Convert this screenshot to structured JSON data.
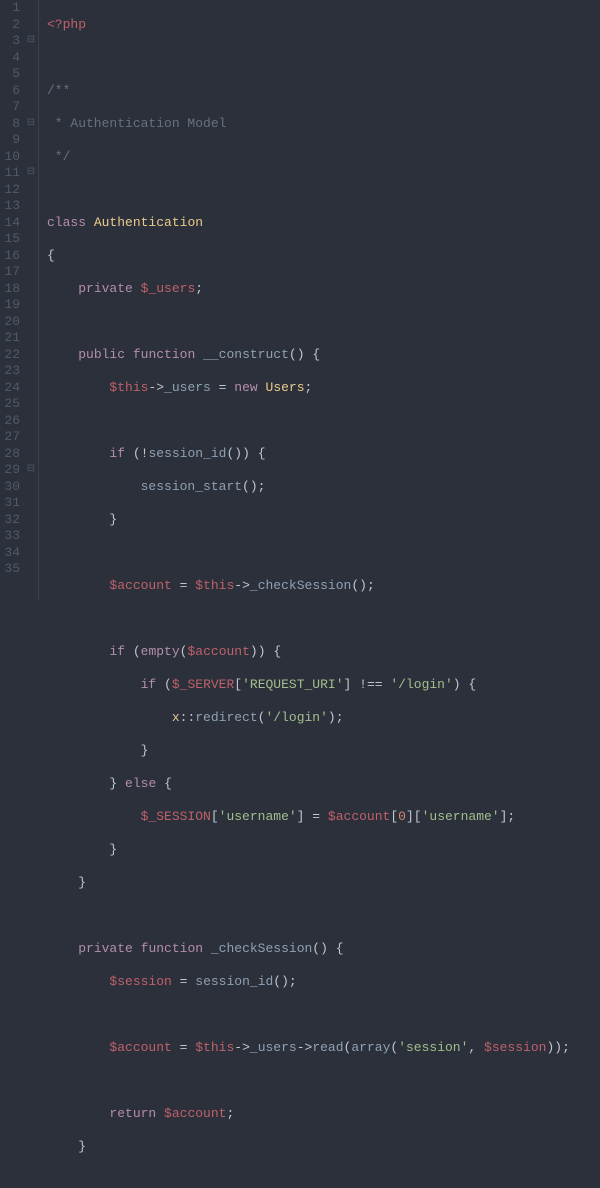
{
  "lineNumbers": [
    "1",
    "2",
    "3",
    "4",
    "5",
    "6",
    "7",
    "8",
    "9",
    "10",
    "11",
    "12",
    "13",
    "14",
    "15",
    "16",
    "17",
    "18",
    "19",
    "20",
    "21",
    "22",
    "23",
    "24",
    "25",
    "26",
    "27",
    "28",
    "29",
    "30",
    "31",
    "32",
    "33",
    "34",
    "35"
  ],
  "folds": {
    "l3": "⊟",
    "l8": "⊟",
    "l11": "⊟",
    "l29": "⊟"
  },
  "tokens": {
    "php_open": "<?php",
    "cmt1": "/**",
    "cmt2": " * Authentication Model",
    "cmt3": " */",
    "kw_class": "class",
    "cls_name": "Authentication",
    "brace_o": "{",
    "brace_c": "}",
    "kw_private": "private",
    "kw_public": "public",
    "kw_function": "function",
    "kw_new": "new",
    "kw_if": "if",
    "kw_else": "else",
    "kw_return": "return",
    "kw_empty": "empty",
    "var_users": "$_users",
    "var_this": "$this",
    "var_account": "$account",
    "var_session": "$session",
    "var_server": "$_SERVER",
    "var_SESSION": "$_SESSION",
    "fn_construct": "__construct",
    "fn_checkSession": "_checkSession",
    "fn_sessionid": "session_id",
    "fn_sessionstart": "session_start",
    "fn_read": "read",
    "fn_redirect": "redirect",
    "fn_array": "array",
    "cls_users": "Users",
    "cls_x": "x",
    "prop_users": "_users",
    "str_requri": "'REQUEST_URI'",
    "str_login": "'/login'",
    "str_username": "'username'",
    "str_session": "'session'",
    "num_0": "0",
    "op_arrow": "->",
    "op_eq": "=",
    "op_neq": "!==",
    "op_sc": "::",
    "semi": ";",
    "comma": ",",
    "paren_o": "(",
    "paren_c": ")",
    "bracket_o": "[",
    "bracket_c": "]",
    "bang": "!",
    "sp": " "
  }
}
